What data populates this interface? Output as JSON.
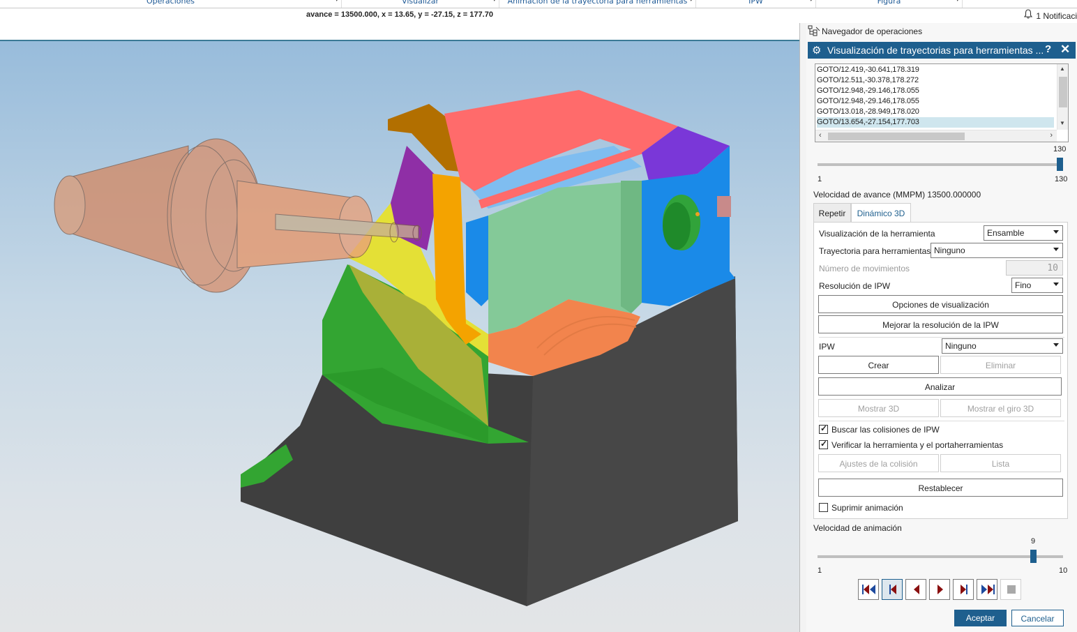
{
  "ribbon": {
    "groups": [
      {
        "label": "Operaciones"
      },
      {
        "label": "Visualizar"
      },
      {
        "label": "Animación de la trayectoria para herramientas"
      },
      {
        "label": "IPW"
      },
      {
        "label": "Figura"
      }
    ]
  },
  "status": {
    "coords_text": "avance = 13500.000, x = 13.65, y = -27.15, z = 177.70",
    "notifications": "1 Notificaci"
  },
  "panel": {
    "navigator_label": "Navegador de operaciones",
    "dialog_title": "Visualización de trayectorias para herramientas ...",
    "help_label": "?",
    "close_label": "✕",
    "gotos": [
      "GOTO/12.419,-30.641,178.319",
      "GOTO/12.511,-30.378,178.272",
      "GOTO/12.948,-29.146,178.055",
      "GOTO/12.948,-29.146,178.055",
      "GOTO/13.018,-28.949,178.020",
      "GOTO/13.654,-27.154,177.703"
    ],
    "selected_goto": 5,
    "motion_slider": {
      "min": "1",
      "max": "130",
      "value": "130",
      "fraction": 1.0
    },
    "feed_rate_text": "Velocidad de avance (MMPM) 13500.000000",
    "tabs": [
      {
        "label": "Repetir",
        "active": false
      },
      {
        "label": "Dinámico 3D",
        "active": true
      }
    ],
    "tool_display_label": "Visualización de la herramienta",
    "tool_display_value": "Ensamble",
    "toolpath_label": "Trayectoria para herramientas",
    "toolpath_value": "Ninguno",
    "motions_label": "Número de movimientos",
    "motions_value": "10",
    "ipw_resolution_label": "Resolución de IPW",
    "ipw_resolution_value": "Fino",
    "display_options_btn": "Opciones de visualización",
    "improve_ipw_btn": "Mejorar la resolución de la IPW",
    "ipw_label": "IPW",
    "ipw_value": "Ninguno",
    "create_btn": "Crear",
    "delete_btn": "Eliminar",
    "analyze_btn": "Analizar",
    "show3d_btn": "Mostrar 3D",
    "show_spin_btn": "Mostrar el giro 3D",
    "check_ipw_collisions": {
      "label": "Buscar las colisiones de IPW",
      "checked": true
    },
    "check_tool_holder": {
      "label": "Verificar la herramienta y el portaherramientas",
      "checked": true
    },
    "collision_settings_btn": "Ajustes de la colisión",
    "list_btn": "Lista",
    "reset_btn": "Restablecer",
    "suppress_anim": {
      "label": "Suprimir animación",
      "checked": false
    },
    "anim_speed_label": "Velocidad de animación",
    "anim_slider": {
      "min": "1",
      "max": "10",
      "value": "9",
      "fraction": 0.89
    },
    "ok_btn": "Aceptar",
    "cancel_btn": "Cancelar"
  },
  "colors": {
    "accent": "#1e5f8e",
    "tool_color": "#e8976a",
    "stock_black": "#3f3f3f",
    "green": "#33a532",
    "salmon": "#ff6b6b",
    "blue": "#1a8ae8",
    "purple": "#7a37d8",
    "mint": "#84c998",
    "orange": "#f2844d"
  }
}
